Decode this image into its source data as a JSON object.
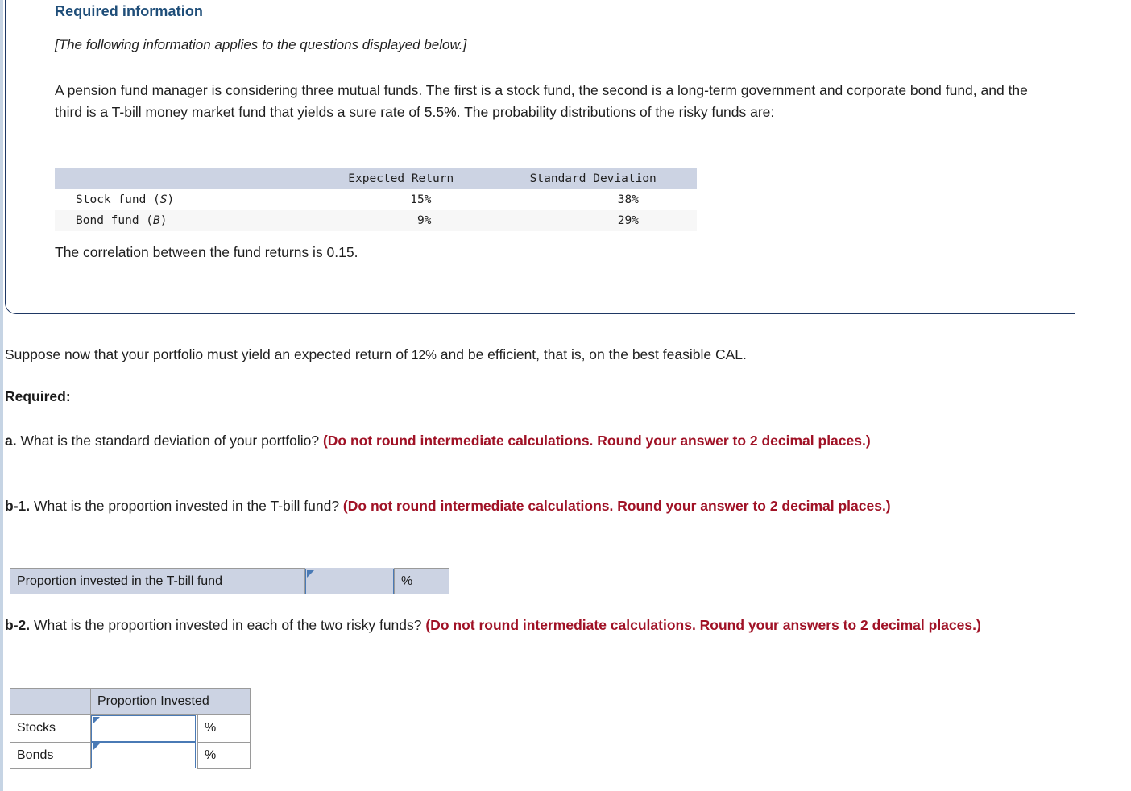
{
  "panel": {
    "heading": "Required information",
    "applies_note": "[The following information applies to the questions displayed below.]",
    "body_paragraph": "A pension fund manager is considering three mutual funds. The first is a stock fund, the second is a long-term government and corporate bond fund, and the third is a T-bill money market fund that yields a sure rate of 5.5%. The probability distributions of the risky funds are:",
    "correlation_text": "The correlation between the fund returns is 0.15."
  },
  "fund_table": {
    "columns": [
      "",
      "Expected Return",
      "Standard Deviation"
    ],
    "rows": [
      {
        "label_prefix": "Stock fund (",
        "label_symbol": "S",
        "label_suffix": ")",
        "expected_return": "15%",
        "standard_deviation": "38%"
      },
      {
        "label_prefix": "Bond fund (",
        "label_symbol": "B",
        "label_suffix": ")",
        "expected_return": "9%",
        "standard_deviation": "29%"
      }
    ]
  },
  "question": {
    "suppose_pre": "Suppose now that your portfolio must yield an expected return of ",
    "suppose_value": "12%",
    "suppose_post": " and be efficient, that is, on the best feasible CAL.",
    "required_label": "Required:",
    "part_a": {
      "tag": "a.",
      "text": " What is the standard deviation of your portfolio? ",
      "note": "(Do not round intermediate calculations. Round your answer to 2 decimal places.)"
    },
    "part_b1": {
      "tag": "b-1.",
      "text": " What is the proportion invested in the T-bill fund? ",
      "note": "(Do not round intermediate calculations. Round your answer to 2 decimal places.)"
    },
    "part_b2": {
      "tag": "b-2.",
      "text": " What is the proportion invested in each of the two risky funds? ",
      "note": "(Do not round intermediate calculations. Round your answers to 2 decimal places.)"
    }
  },
  "answers": {
    "b1": {
      "row_label": "Proportion invested in the T-bill fund",
      "value": "",
      "unit": "%"
    },
    "b2": {
      "corner_header": "",
      "column_header": "Proportion Invested",
      "rows": [
        {
          "label": "Stocks",
          "value": "",
          "unit": "%"
        },
        {
          "label": "Bonds",
          "value": "",
          "unit": "%"
        }
      ]
    }
  },
  "colors": {
    "heading_blue": "#1f4e79",
    "panel_border": "#1f3864",
    "note_red": "#a01226",
    "table_header_bg": "#ccd3e3",
    "input_border_blue": "#4a7ab5"
  }
}
